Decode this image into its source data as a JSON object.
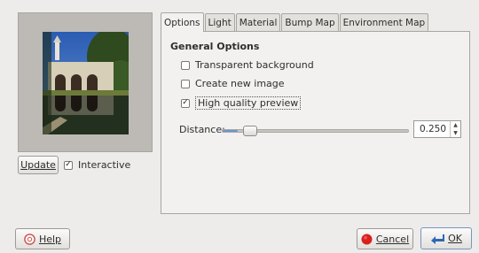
{
  "preview": {
    "update_label": "Update",
    "interactive_label": "Interactive",
    "interactive_checked": true
  },
  "tabs": [
    {
      "label": "Options",
      "active": true
    },
    {
      "label": "Light",
      "active": false
    },
    {
      "label": "Material",
      "active": false
    },
    {
      "label": "Bump Map",
      "active": false
    },
    {
      "label": "Environment Map",
      "active": false
    }
  ],
  "options": {
    "section_title": "General Options",
    "transparent_background": {
      "label": "Transparent background",
      "checked": false
    },
    "create_new_image": {
      "label": "Create new image",
      "checked": false
    },
    "high_quality_preview": {
      "label": "High quality preview",
      "checked": true
    },
    "distance": {
      "label": "Distance:",
      "value": "0.250",
      "slider_fraction": 0.08
    }
  },
  "footer": {
    "help_label": "Help",
    "cancel_label": "Cancel",
    "ok_label": "OK"
  },
  "colors": {
    "accent": "#6a96d0",
    "cancel_icon": "#d8211e",
    "ok_icon": "#2d67b8"
  },
  "icons": {
    "help": "help-icon",
    "cancel": "cancel-icon",
    "ok": "ok-arrow-icon"
  }
}
